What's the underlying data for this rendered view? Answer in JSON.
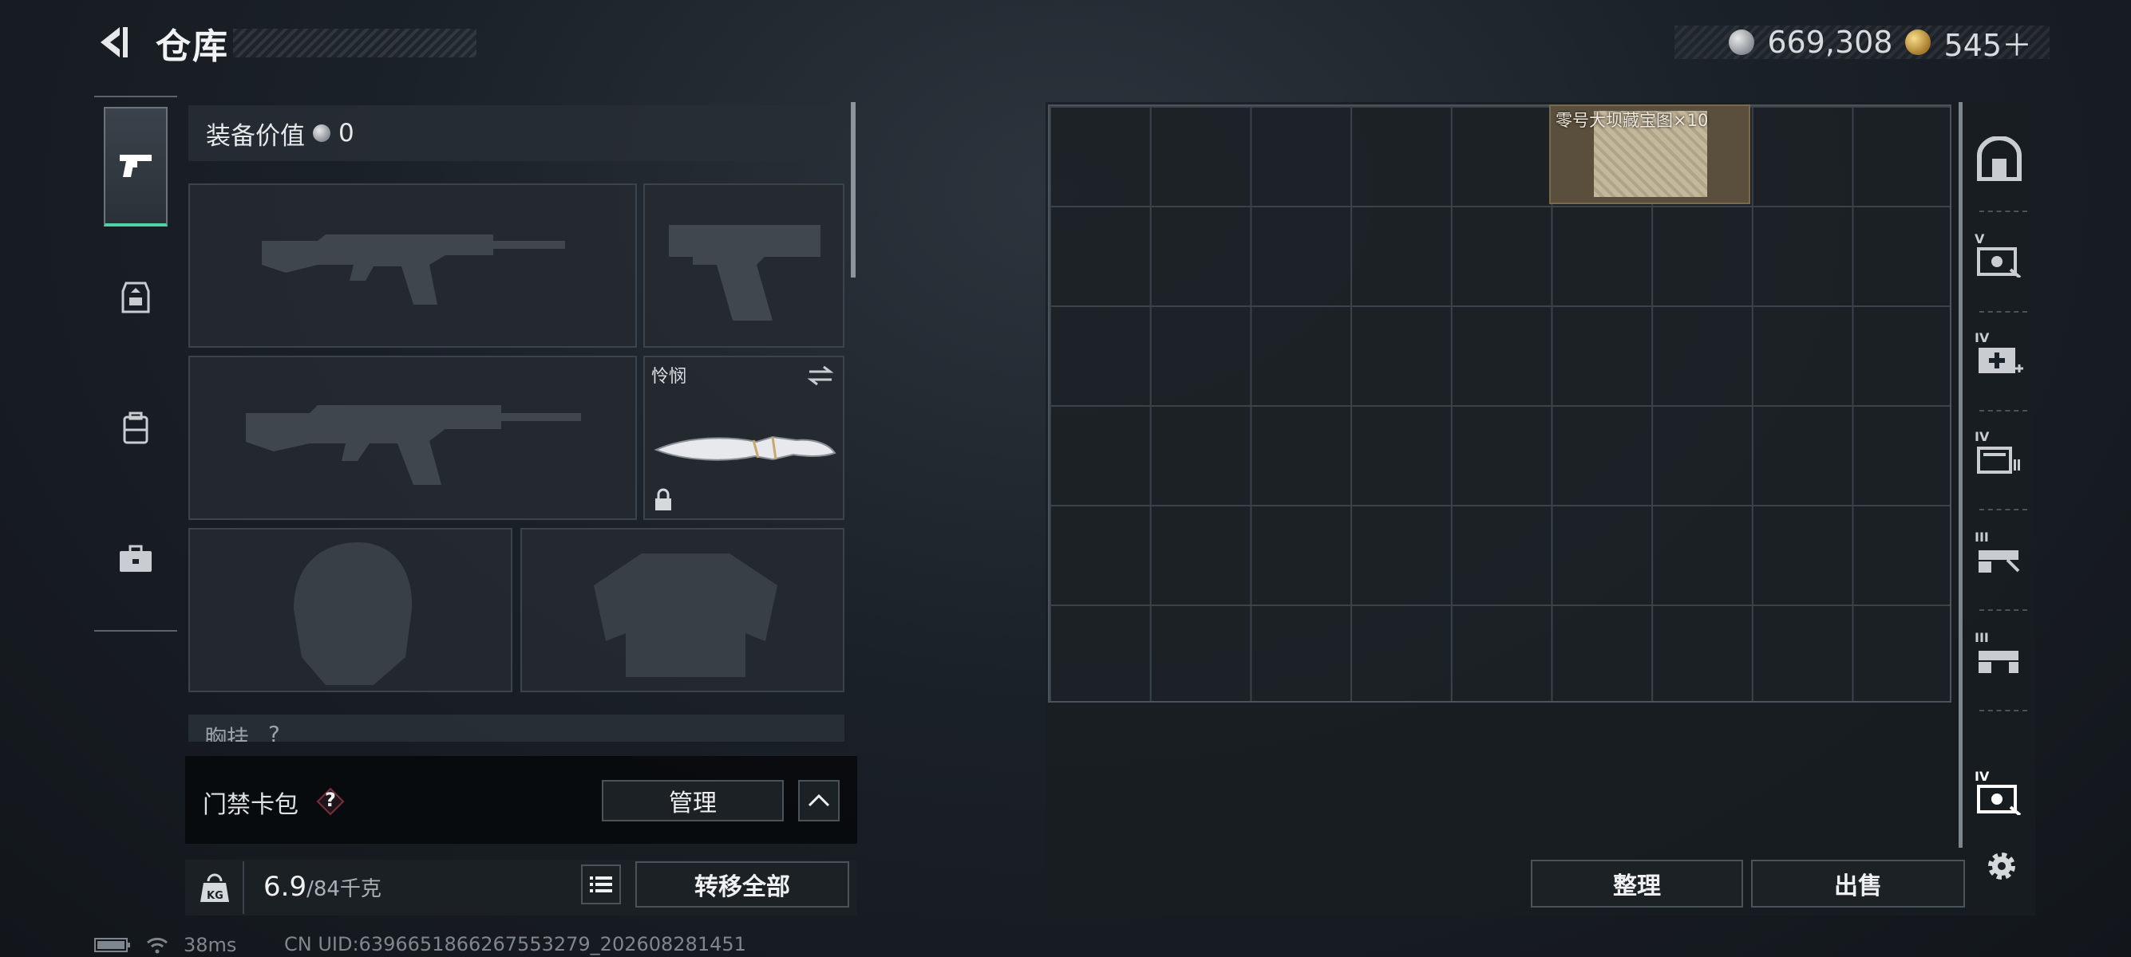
{
  "header": {
    "title": "仓库",
    "currency_silver": "669,308",
    "currency_gold": "545＋"
  },
  "equipment": {
    "value_label": "装备价值",
    "value_amount": "0",
    "melee_name": "怜悯",
    "chest_label": "胸挂",
    "chest_count": "?"
  },
  "keycard": {
    "label": "门禁卡包",
    "help": "?",
    "manage_label": "管理"
  },
  "weight": {
    "kg_badge": "KG",
    "current": "6.9",
    "capacity": "/84千克"
  },
  "actions": {
    "transfer_all": "转移全部",
    "sort": "整理",
    "sell": "出售"
  },
  "storage": {
    "item_label": "零号大坝藏宝图×10"
  },
  "rail": {
    "levels": [
      "V",
      "IV",
      "IV",
      "III",
      "III",
      "IV"
    ]
  },
  "status_bar": {
    "ping": "38ms",
    "uid": "CN UID:6396651866267553279_202608281451"
  }
}
